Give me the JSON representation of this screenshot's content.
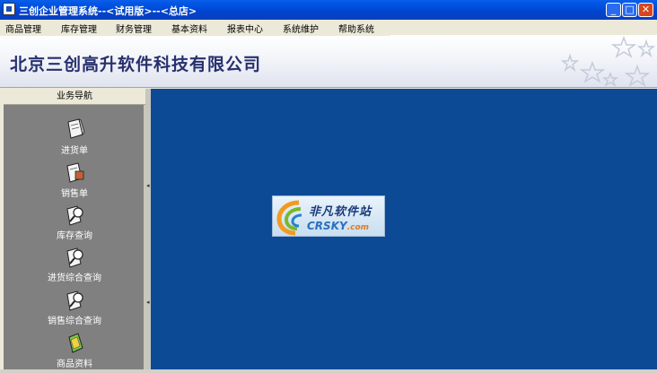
{
  "window": {
    "title": "三创企业管理系统--<试用版>--<总店>",
    "buttons": {
      "minimize": "_",
      "maximize": "□",
      "close": "✕"
    }
  },
  "menu": {
    "items": [
      "商品管理",
      "库存管理",
      "财务管理",
      "基本资料",
      "报表中心",
      "系统维护",
      "帮助系统"
    ]
  },
  "banner": {
    "company_name": "北京三创高升软件科技有限公司"
  },
  "nav": {
    "header": "业务导航",
    "items": [
      {
        "label": "进货单",
        "icon": "purchase-order-icon"
      },
      {
        "label": "销售单",
        "icon": "sales-order-icon"
      },
      {
        "label": "库存查询",
        "icon": "inventory-query-icon"
      },
      {
        "label": "进货综合查询",
        "icon": "purchase-query-icon"
      },
      {
        "label": "销售综合查询",
        "icon": "sales-query-icon"
      },
      {
        "label": "商品资料",
        "icon": "product-info-icon"
      }
    ]
  },
  "watermark": {
    "cn": "非凡软件站",
    "en": "CRSKY",
    "domain": ".com"
  },
  "colors": {
    "titlebar": "#0055e5",
    "main_background": "#0d4a96",
    "nav_background": "#808080",
    "company_text": "#27306e"
  }
}
